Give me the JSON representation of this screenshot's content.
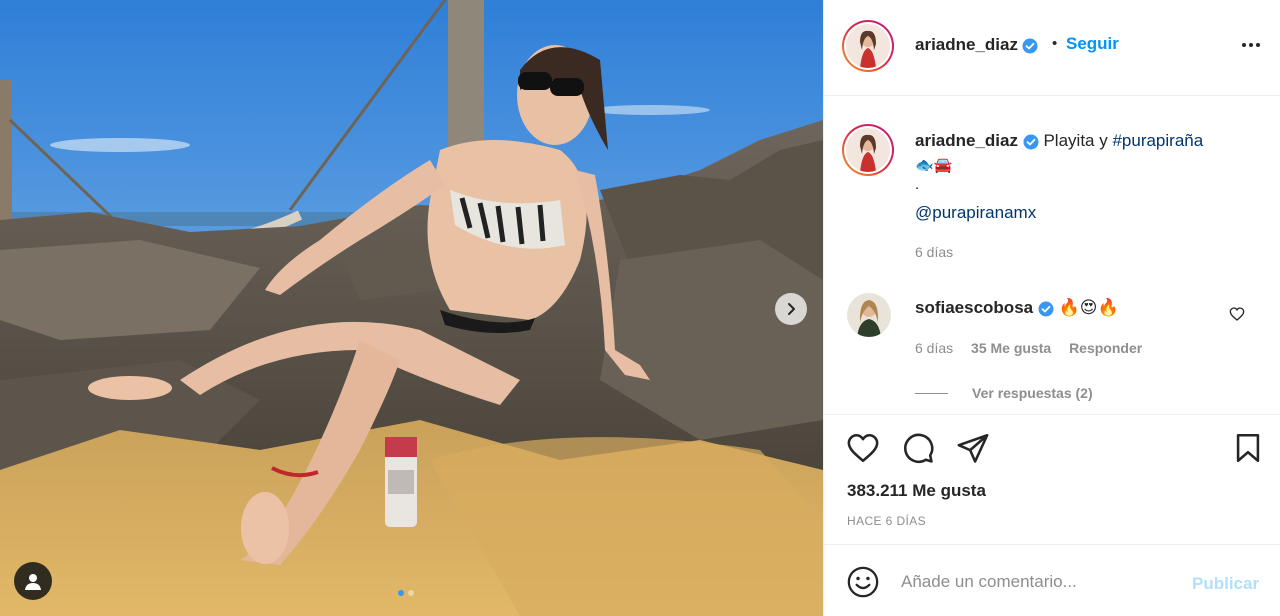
{
  "post": {
    "author": "ariadne_diaz",
    "follow_label": "Seguir",
    "separator": "•",
    "caption_text": "Playita y ",
    "hashtag": "#purapiraña",
    "caption_emoji": "🐟🚘",
    "caption_dot": ".",
    "mention": "@purapiranamx",
    "caption_time": "6 días",
    "likes_label": "383.211 Me gusta",
    "posted_ago": "HACE 6 DÍAS",
    "carousel": {
      "current": 1,
      "total": 2
    }
  },
  "comment": {
    "user": "sofiaescobosa",
    "text": "🔥😍🔥",
    "time": "6 días",
    "likes": "35 Me gusta",
    "reply_label": "Responder",
    "view_replies": "Ver respuestas (2)"
  },
  "composer": {
    "placeholder": "Añade un comentario...",
    "publish_label": "Publicar"
  },
  "colors": {
    "accent": "#0095f6",
    "link": "#00376b",
    "muted": "#8e8e8e",
    "publish_disabled": "#b2dffc"
  },
  "icons": [
    "more-options-icon",
    "verified-badge-icon",
    "heart-icon",
    "comment-icon",
    "share-icon",
    "save-bookmark-icon",
    "emoji-smile-icon",
    "chevron-right-icon",
    "user-tag-icon"
  ]
}
